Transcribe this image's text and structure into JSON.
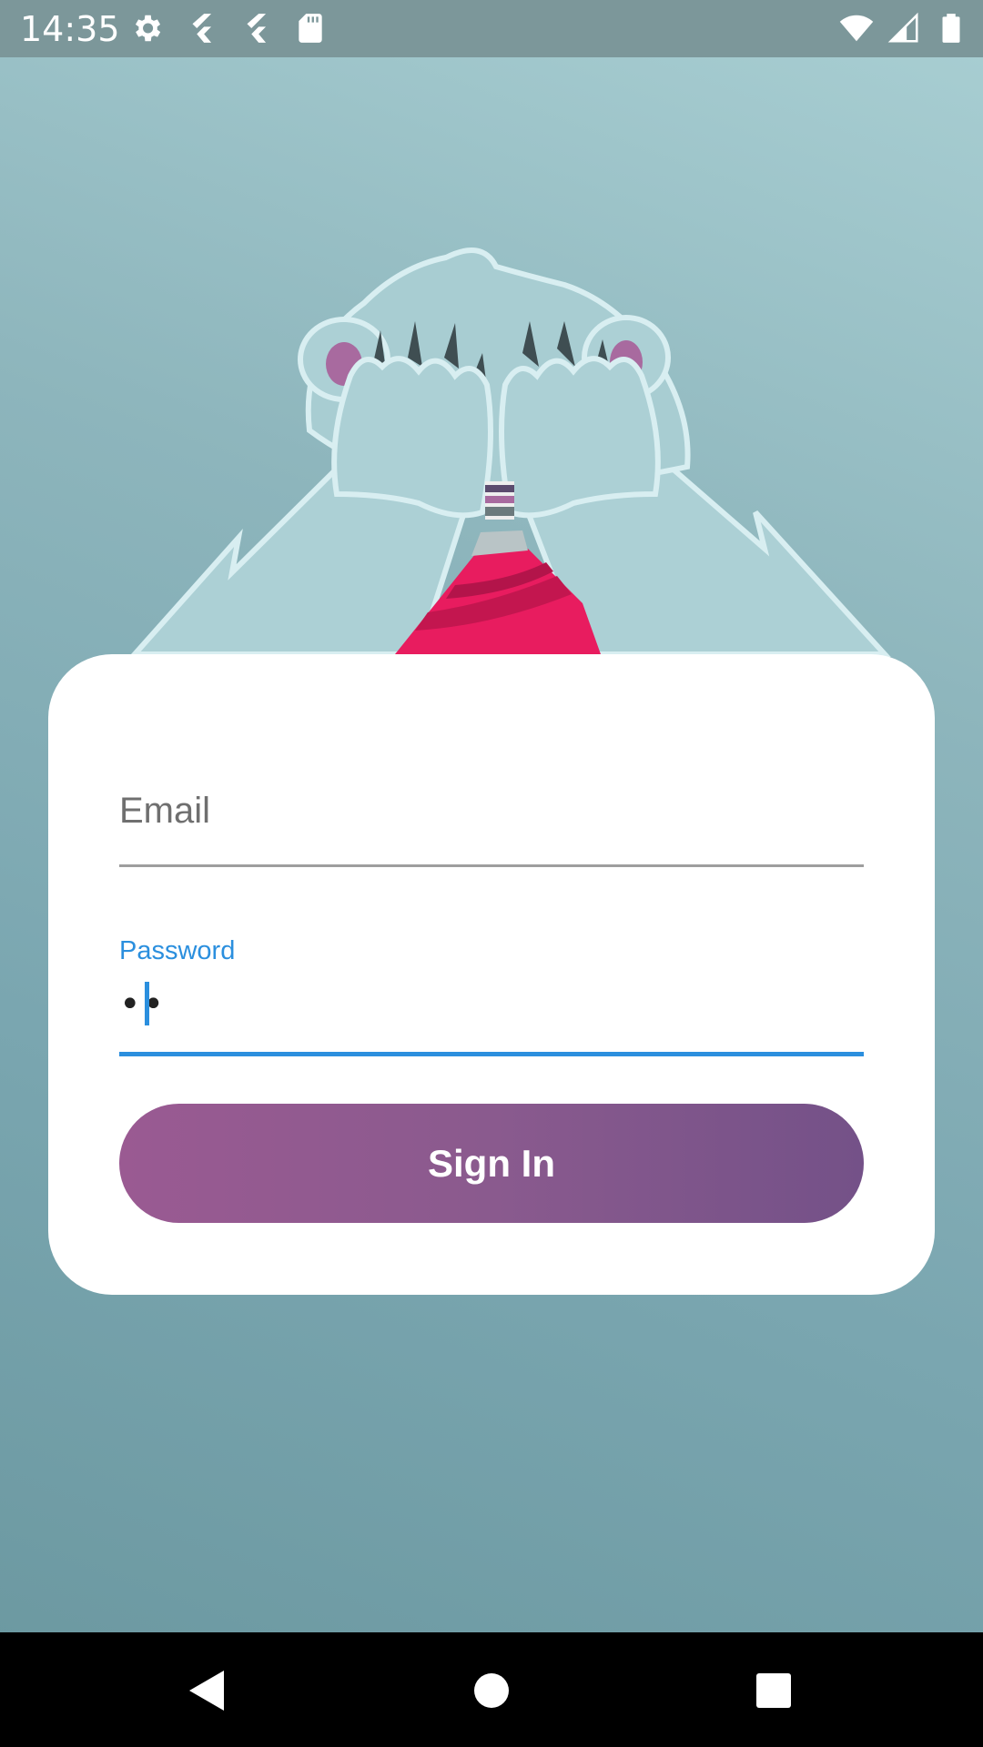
{
  "status_bar": {
    "time": "14:35",
    "left_icons": [
      "settings-icon",
      "flutter-icon",
      "flutter-icon",
      "sd-card-icon"
    ],
    "right_icons": [
      "wifi-icon",
      "cellular-signal-icon",
      "battery-icon"
    ]
  },
  "illustration": {
    "subject": "teddy-bear-covering-eyes-illustration",
    "colors": {
      "fur": "#acd0d5",
      "fur_outline": "#d8eef1",
      "ear_inner": "#a86a9f",
      "scarf": "#e81c5f",
      "claws": "#3f4e52"
    }
  },
  "login_form": {
    "email": {
      "label": "Email",
      "value": ""
    },
    "password": {
      "label": "Password",
      "value": "••",
      "focused": true
    },
    "sign_in_label": "Sign In"
  },
  "nav_bar": {
    "buttons": [
      "back-icon",
      "home-icon",
      "recents-icon"
    ]
  },
  "colors": {
    "accent_blue": "#2b8fde",
    "button_gradient_start": "#9a5a92",
    "button_gradient_end": "#745188",
    "background_top": "#a9cfd3",
    "background_bottom": "#6a979f"
  }
}
